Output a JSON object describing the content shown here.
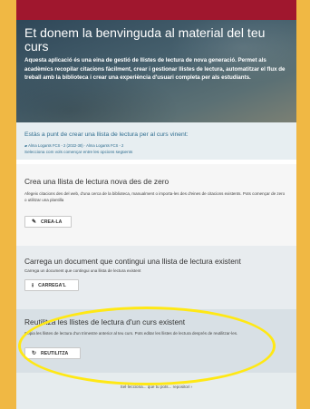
{
  "hero": {
    "title": "Et donem la benvinguda al material del teu curs",
    "description": "Aquesta aplicació és una eina de gestió de llistes de lectura de nova generació. Permet als acadèmics recopilar citacions fàcilment, crear i gestionar llistes de lectura, automatitzar el flux de treball amb la biblioteca i crear una experiència d'usuari completa per als estudiants."
  },
  "info": {
    "title": "Estàs a punt de crear una llista de lectura per al curs vinent:",
    "course_meta": "Alma Logants FCS - 2 (2022-38) · Alma Logants FCS - 2",
    "link": "Selecciona com vols començar entre les opcions següents"
  },
  "sections": [
    {
      "title": "Crea una llista de lectura nova des de zero",
      "description": "Afegeix citacions des del web, d'una cerca de la biblioteca, manualment o importa-les des d'eines de citacions existents. Pots començar de zero o utilitzar una plantilla",
      "button_label": "CREA-LA",
      "button_icon": "pencil-icon"
    },
    {
      "title": "Carrega un document que contingui una llista de lectura existent",
      "description": "Carrega un document que contingui una llista de lectura existent",
      "button_label": "CARREGA'L",
      "button_icon": "upload-icon"
    },
    {
      "title": "Reutilitza les llistes de lectura d'un curs existent",
      "description": "Copia les llistes de lectura d'un trimestre anterior al teu curs. Pots editar les llistes de lectura després de reutilitzar-les.",
      "button_label": "REUTILITZA",
      "button_icon": "reuse-icon"
    }
  ],
  "footer": {
    "link": "Sel·lecciona... que tu pots... repositori ›"
  },
  "colors": {
    "page_background": "#f0b844",
    "top_bar": "#a0172e",
    "link": "#2f6d8f",
    "highlight": "#ffe814"
  }
}
